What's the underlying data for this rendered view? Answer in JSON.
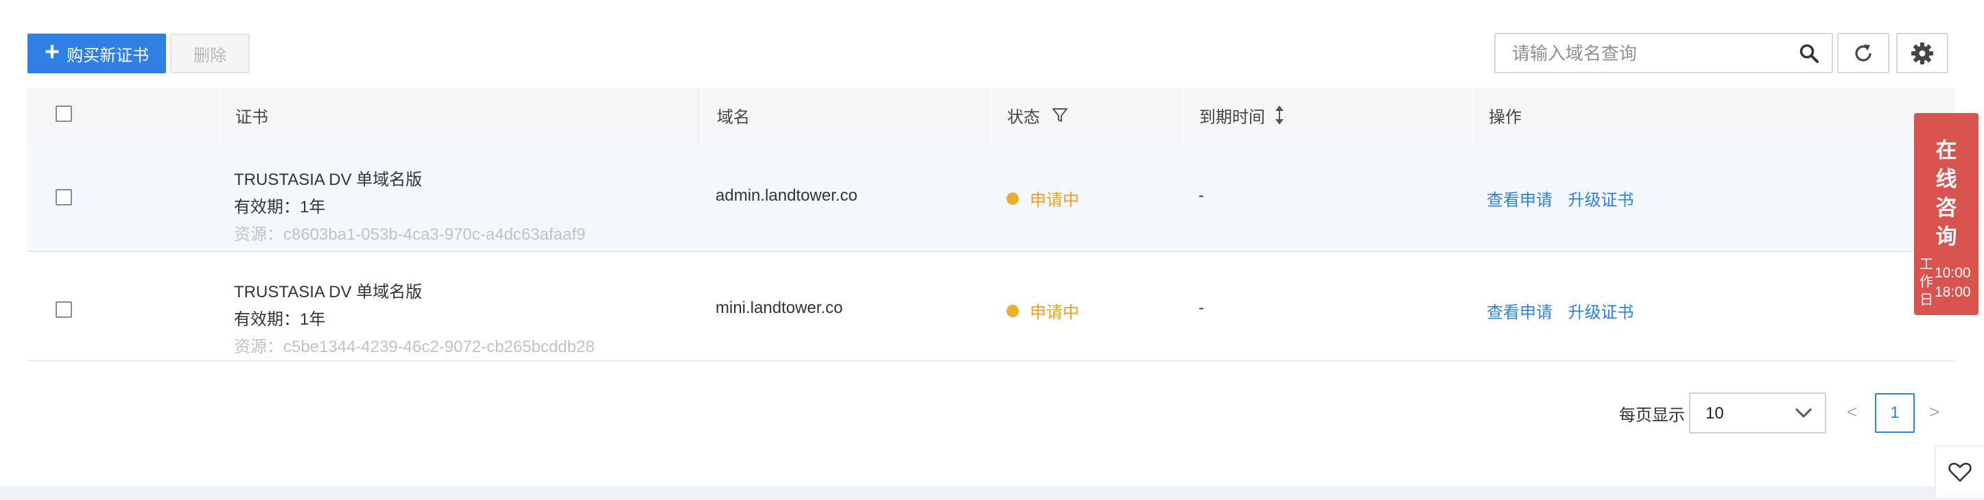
{
  "toolbar": {
    "buy_label": "购买新证书",
    "delete_label": "删除",
    "search_placeholder": "请输入域名查询"
  },
  "table": {
    "headers": {
      "certificate": "证书",
      "domain": "域名",
      "status": "状态",
      "expire": "到期时间",
      "action": "操作"
    },
    "rows": [
      {
        "name": "TRUSTASIA DV 单域名版",
        "validity": "有效期：1年",
        "resource": "资源：c8603ba1-053b-4ca3-970c-a4dc63afaaf9",
        "domain": "admin.landtower.co",
        "status": "申请中",
        "expire": "-",
        "action_view": "查看申请",
        "action_upgrade": "升级证书"
      },
      {
        "name": "TRUSTASIA DV 单域名版",
        "validity": "有效期：1年",
        "resource": "资源：c5be1344-4239-46c2-9072-cb265bcddb28",
        "domain": "mini.landtower.co",
        "status": "申请中",
        "expire": "-",
        "action_view": "查看申请",
        "action_upgrade": "升级证书"
      }
    ]
  },
  "pagination": {
    "page_size_label": "每页显示",
    "page_size": "10",
    "prev": "<",
    "next": ">",
    "current_page": "1"
  },
  "consult_widget": {
    "title": "在线咨询",
    "workday": "工作日",
    "hours_start": "10:00",
    "hours_end": "18:00"
  },
  "colors": {
    "primary": "#2f7fe4",
    "status_pending": "#efad2c",
    "consult_bg": "#d9534f",
    "row_highlight": "#f3f8fc"
  }
}
